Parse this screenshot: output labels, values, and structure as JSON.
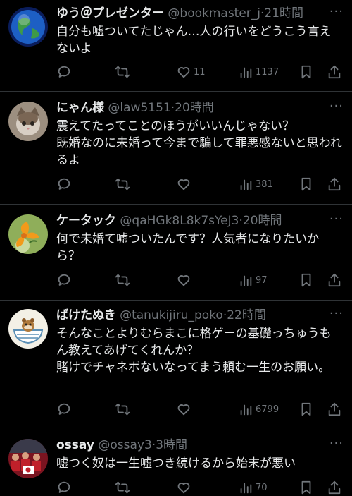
{
  "replies": [
    {
      "name": "ゆう＠プレゼンター",
      "handle": "@bookmaster_j",
      "time": "21時間",
      "text": "自分も嘘ついてたじゃん…人の行いをどうこう言えないよ",
      "likes": "11",
      "views": "1137",
      "avatar_icon": "earth-avatar-icon"
    },
    {
      "name": "にゃん様",
      "handle": "@law5151",
      "time": "20時間",
      "text": "震えてたってことのほうがいいんじゃない？\n既婚なのに未婚って今まで騙して罪悪感ないと思われるよ",
      "likes": "",
      "views": "381",
      "avatar_icon": "cat-avatar-icon"
    },
    {
      "name": "ケータック",
      "handle": "@qaHGk8L8k7sYeJ3",
      "time": "20時間",
      "text": "何で未婚て嘘ついたんです？人気者になりたいから？",
      "likes": "",
      "views": "97",
      "avatar_icon": "flower-avatar-icon"
    },
    {
      "name": "ばけたぬき",
      "handle": "@tanukijiru_poko",
      "time": "22時間",
      "text": "そんなことよりむらまこに格ゲーの基礎っちゅうもん教えてあげてくれんか？\n賭けでチャネポないなってまう頼む一生のお願い。",
      "likes": "",
      "views": "6799",
      "avatar_icon": "tanuki-bowl-avatar-icon"
    },
    {
      "name": "ossay",
      "handle": "@ossay3",
      "time": "3時間",
      "text": "嘘つく奴は一生嘘つき続けるから始末が悪い",
      "likes": "",
      "views": "70",
      "avatar_icon": "crowd-flag-avatar-icon"
    }
  ],
  "separator": "·",
  "more_glyph": "···",
  "colors": {
    "background": "#000000",
    "text": "#e7e9ea",
    "muted": "#71767b",
    "divider": "#2f3336"
  }
}
